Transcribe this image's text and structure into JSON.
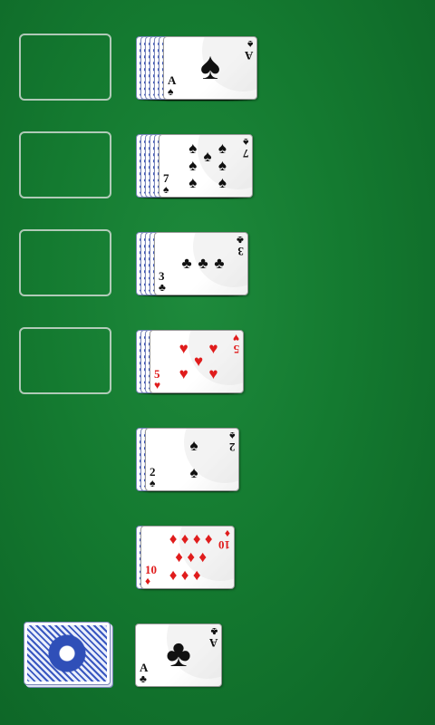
{
  "tableau": {
    "foundation_slots": 4,
    "rows": [
      {
        "backs": 6,
        "card": {
          "rank": "A",
          "suit": "♠",
          "color": "black",
          "layout": "big"
        }
      },
      {
        "backs": 5,
        "card": {
          "rank": "7",
          "suit": "♠",
          "color": "black",
          "layout": "seven"
        }
      },
      {
        "backs": 4,
        "card": {
          "rank": "3",
          "suit": "♣",
          "color": "black",
          "layout": "three"
        }
      },
      {
        "backs": 3,
        "card": {
          "rank": "5",
          "suit": "♥",
          "color": "red",
          "layout": "five"
        }
      },
      {
        "backs": 2,
        "card": {
          "rank": "2",
          "suit": "♠",
          "color": "black",
          "layout": "two"
        }
      },
      {
        "backs": 1,
        "card": {
          "rank": "10",
          "suit": "♦",
          "color": "red",
          "layout": "ten"
        }
      }
    ]
  },
  "stock": {
    "icon": "card-back-pattern-icon"
  },
  "waste": {
    "card": {
      "rank": "A",
      "suit": "♣",
      "color": "black",
      "layout": "big"
    }
  },
  "colors": {
    "felt": "#147a30",
    "red_suit": "#e01c1c",
    "black_suit": "#111111",
    "card_back": "#3c56b8"
  }
}
